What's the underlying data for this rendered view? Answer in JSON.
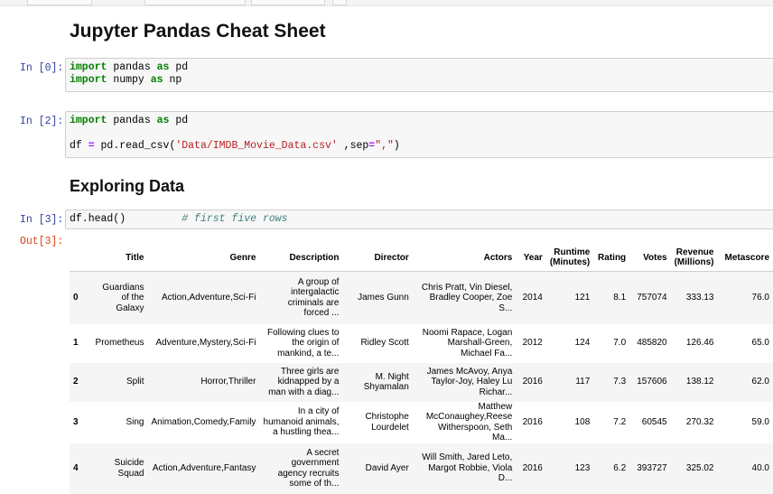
{
  "notebook": {
    "title": "Jupyter Pandas Cheat Sheet",
    "section_heading": "Exploring Data"
  },
  "cells": [
    {
      "prompt": "In [0]:",
      "lines": [
        [
          {
            "t": "import",
            "c": "kw"
          },
          {
            "t": " pandas "
          },
          {
            "t": "as",
            "c": "kw"
          },
          {
            "t": " pd"
          }
        ],
        [
          {
            "t": "import",
            "c": "kw"
          },
          {
            "t": " numpy "
          },
          {
            "t": "as",
            "c": "kw"
          },
          {
            "t": " np"
          }
        ]
      ]
    },
    {
      "prompt": "In [2]:",
      "lines": [
        [
          {
            "t": "import",
            "c": "kw"
          },
          {
            "t": " pandas "
          },
          {
            "t": "as",
            "c": "kw"
          },
          {
            "t": " pd"
          }
        ],
        [
          {
            "t": ""
          }
        ],
        [
          {
            "t": "df "
          },
          {
            "t": "=",
            "c": "op"
          },
          {
            "t": " pd.read_csv("
          },
          {
            "t": "'Data/IMDB_Movie_Data.csv'",
            "c": "str"
          },
          {
            "t": " ,sep"
          },
          {
            "t": "=",
            "c": "op"
          },
          {
            "t": "\",\"",
            "c": "str"
          },
          {
            "t": ")"
          }
        ]
      ]
    },
    {
      "prompt": "In [3]:",
      "lines": [
        [
          {
            "t": "df.head()         "
          },
          {
            "t": "# first five rows",
            "c": "cm"
          }
        ]
      ]
    }
  ],
  "output": {
    "prompt": "Out[3]:",
    "columns": [
      {
        "label": "",
        "key": "idx"
      },
      {
        "label": "Title",
        "key": "title"
      },
      {
        "label": "Genre",
        "key": "genre"
      },
      {
        "label": "Description",
        "key": "description"
      },
      {
        "label": "Director",
        "key": "director"
      },
      {
        "label": "Actors",
        "key": "actors"
      },
      {
        "label": "Year",
        "key": "year"
      },
      {
        "label": "Runtime (Minutes)",
        "key": "runtime"
      },
      {
        "label": "Rating",
        "key": "rating"
      },
      {
        "label": "Votes",
        "key": "votes"
      },
      {
        "label": "Revenue (Millions)",
        "key": "revenue"
      },
      {
        "label": "Metascore",
        "key": "metascore"
      }
    ],
    "rows": [
      {
        "idx": "0",
        "title": "Guardians of the Galaxy",
        "genre": "Action,Adventure,Sci-Fi",
        "description": "A group of intergalactic criminals are forced ...",
        "director": "James Gunn",
        "actors": "Chris Pratt, Vin Diesel, Bradley Cooper, Zoe S...",
        "year": "2014",
        "runtime": "121",
        "rating": "8.1",
        "votes": "757074",
        "revenue": "333.13",
        "metascore": "76.0"
      },
      {
        "idx": "1",
        "title": "Prometheus",
        "genre": "Adventure,Mystery,Sci-Fi",
        "description": "Following clues to the origin of mankind, a te...",
        "director": "Ridley Scott",
        "actors": "Noomi Rapace, Logan Marshall-Green, Michael Fa...",
        "year": "2012",
        "runtime": "124",
        "rating": "7.0",
        "votes": "485820",
        "revenue": "126.46",
        "metascore": "65.0"
      },
      {
        "idx": "2",
        "title": "Split",
        "genre": "Horror,Thriller",
        "description": "Three girls are kidnapped by a man with a diag...",
        "director": "M. Night Shyamalan",
        "actors": "James McAvoy, Anya Taylor-Joy, Haley Lu Richar...",
        "year": "2016",
        "runtime": "117",
        "rating": "7.3",
        "votes": "157606",
        "revenue": "138.12",
        "metascore": "62.0"
      },
      {
        "idx": "3",
        "title": "Sing",
        "genre": "Animation,Comedy,Family",
        "description": "In a city of humanoid animals, a hustling thea...",
        "director": "Christophe Lourdelet",
        "actors": "Matthew McConaughey,Reese Witherspoon, Seth Ma...",
        "year": "2016",
        "runtime": "108",
        "rating": "7.2",
        "votes": "60545",
        "revenue": "270.32",
        "metascore": "59.0"
      },
      {
        "idx": "4",
        "title": "Suicide Squad",
        "genre": "Action,Adventure,Fantasy",
        "description": "A secret government agency recruits some of th...",
        "director": "David Ayer",
        "actors": "Will Smith, Jared Leto, Margot Robbie, Viola D...",
        "year": "2016",
        "runtime": "123",
        "rating": "6.2",
        "votes": "393727",
        "revenue": "325.02",
        "metascore": "40.0"
      }
    ]
  }
}
